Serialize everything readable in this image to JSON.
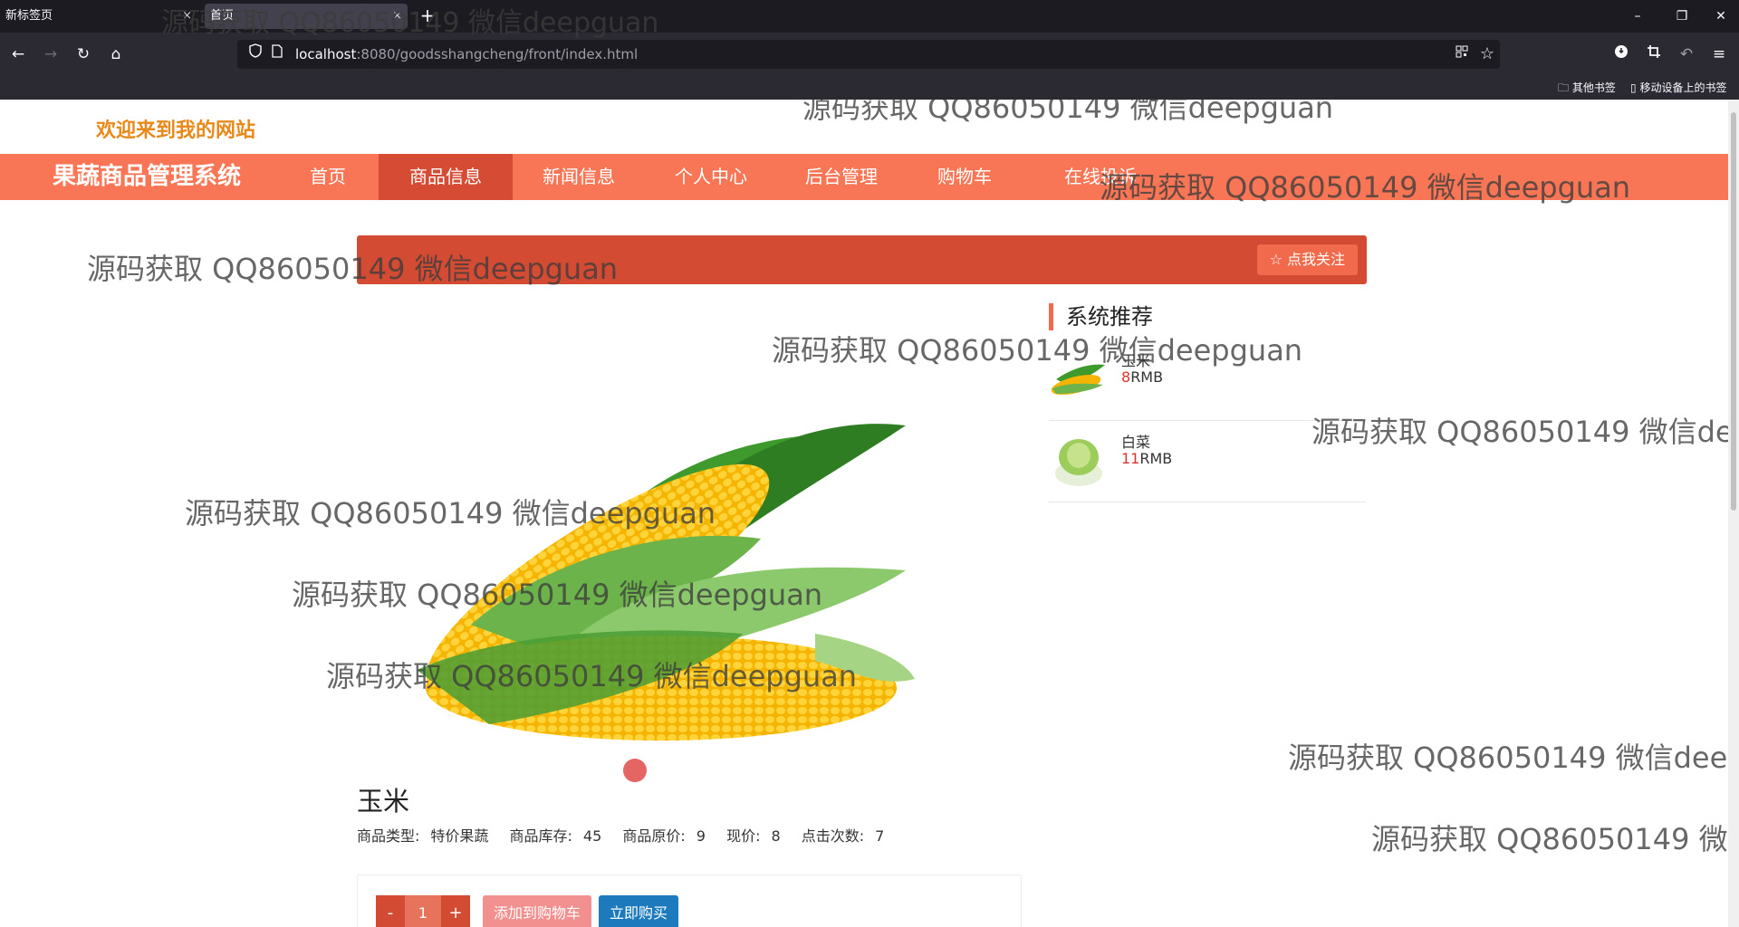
{
  "browser": {
    "tabs": [
      {
        "label": "新标签页",
        "close": "×"
      },
      {
        "label": "首页",
        "close": "×"
      }
    ],
    "new_tab": "+",
    "window_controls": {
      "minimize": "–",
      "restore": "❐",
      "close": "✕"
    },
    "nav": {
      "back": "←",
      "forward": "→",
      "reload": "↻",
      "home": "⌂"
    },
    "url": {
      "host": "localhost",
      "rest": ":8080/goodsshangcheng/front/index.html"
    },
    "bookmarks": {
      "other": "其他书签",
      "mobile": "移动设备上的书签"
    }
  },
  "site": {
    "welcome": "欢迎来到我的网站",
    "brand": "果蔬商品管理系统",
    "nav": [
      {
        "label": "首页"
      },
      {
        "label": "商品信息"
      },
      {
        "label": "新闻信息"
      },
      {
        "label": "个人中心"
      },
      {
        "label": "后台管理"
      },
      {
        "label": "购物车"
      },
      {
        "label": "在线投诉"
      }
    ],
    "follow_label": "☆ 点我关注"
  },
  "recommend": {
    "title": "系统推荐",
    "items": [
      {
        "name": "玉米",
        "price": "8",
        "unit": "RMB"
      },
      {
        "name": "白菜",
        "price": "11",
        "unit": "RMB"
      }
    ]
  },
  "product": {
    "name": "玉米",
    "meta": [
      {
        "label": "商品类型:",
        "value": "特价果蔬"
      },
      {
        "label": "商品库存:",
        "value": "45"
      },
      {
        "label": "商品原价:",
        "value": "9"
      },
      {
        "label": "现价:",
        "value": "8"
      },
      {
        "label": "点击次数:",
        "value": "7"
      }
    ],
    "qty_minus": "-",
    "qty": "1",
    "qty_plus": "+",
    "add_to_cart": "添加到购物车",
    "buy_now": "立即购买"
  },
  "watermark": "源码获取 QQ86050149 微信deepguan",
  "colors": {
    "accent": "#f87655",
    "active": "#d64b33",
    "title_bar": "#d44b33",
    "buy": "#1d7bbd",
    "cart": "#f28f8f"
  }
}
